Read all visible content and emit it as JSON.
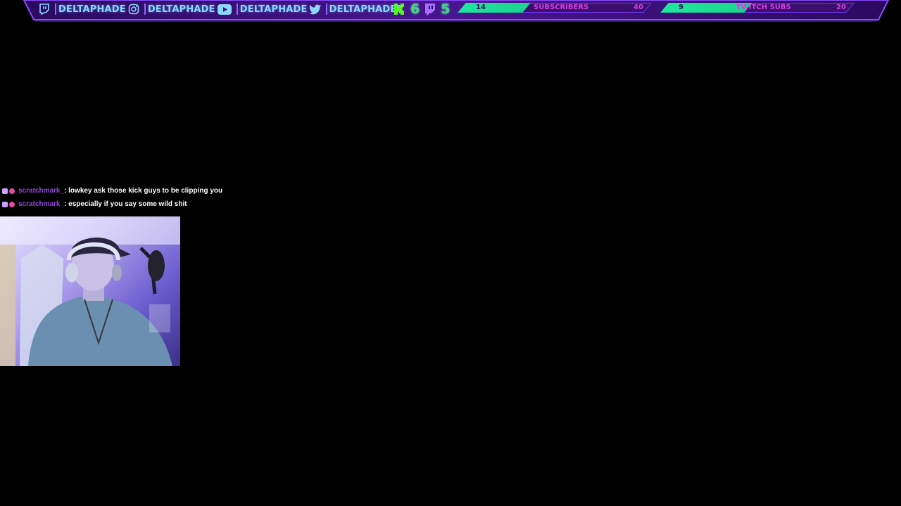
{
  "socials": [
    {
      "icon": "twitch-icon",
      "handle": "DELTAPHADE"
    },
    {
      "icon": "instagram-icon",
      "handle": "DELTAPHADE"
    },
    {
      "icon": "youtube-icon",
      "handle": "DELTAPHADE"
    },
    {
      "icon": "twitter-icon",
      "handle": "DELTAPHADEX"
    }
  ],
  "counters": {
    "kick_count": "6",
    "twitch_count": "5"
  },
  "goals": [
    {
      "label": "SUBSCRIBERS",
      "current": "14",
      "target": "40",
      "progress": 0.35
    },
    {
      "label": "TWITCH SUBS",
      "current": "9",
      "target": "20",
      "progress": 0.45
    }
  ],
  "chat": [
    {
      "user": "scratchmark_",
      "message": ": lowkey ask those kick guys to be clipping you"
    },
    {
      "user": "scratchmark_",
      "message": ": especially if you say some wild shit"
    }
  ],
  "colors": {
    "accent_purple": "#7b3cff",
    "goal_green": "#1fe59c",
    "handle_blue": "#8ad8ff",
    "chat_user": "#8f4ad8"
  }
}
